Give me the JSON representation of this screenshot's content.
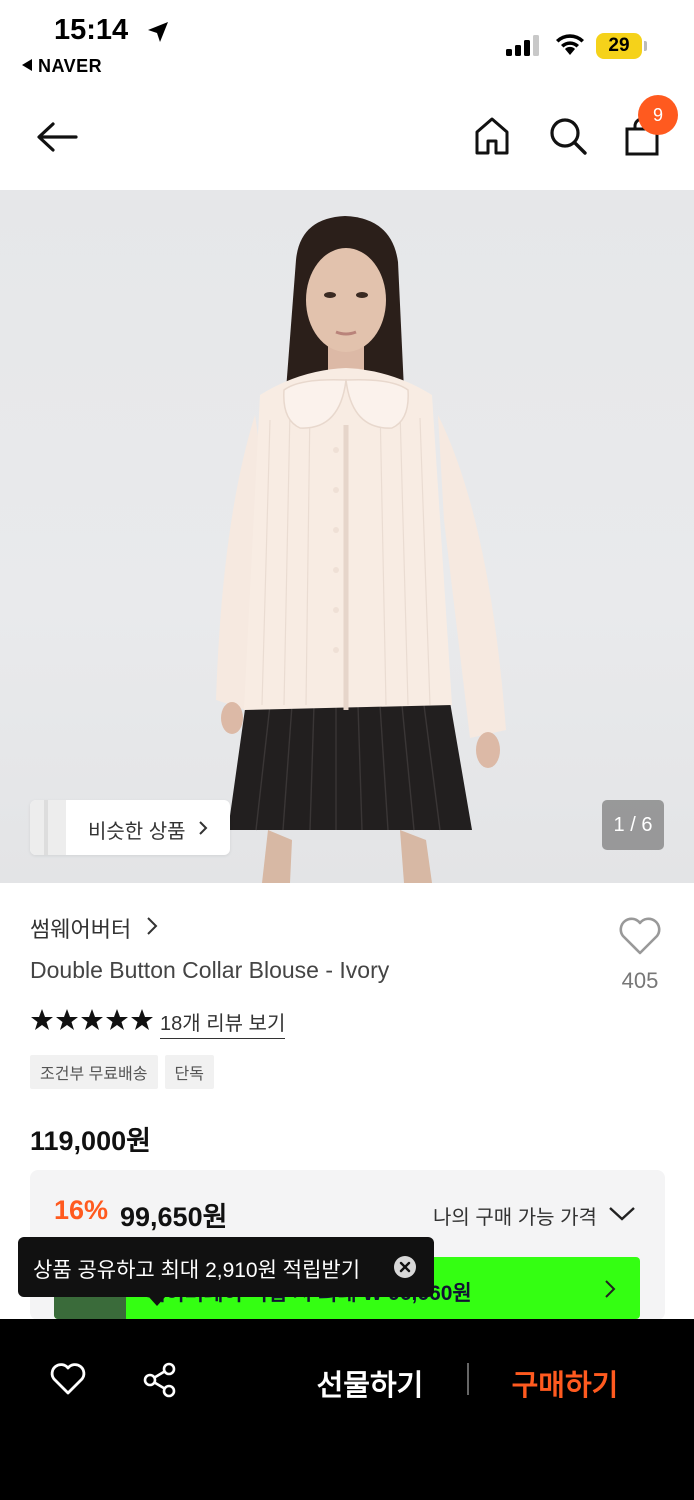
{
  "status_bar": {
    "time": "15:14",
    "back_app": "NAVER",
    "battery": "29"
  },
  "header": {
    "cart_count": "9",
    "icons": [
      "back-arrow-icon",
      "home-icon",
      "search-icon",
      "shopping-bag-icon"
    ]
  },
  "gallery": {
    "similar_label": "비슷한 상품",
    "page_indicator": "1 / 6"
  },
  "product": {
    "brand": "썸웨어버터",
    "title": "Double Button Collar Blouse - Ivory",
    "like_count": "405",
    "rating_stars": 5,
    "review_link": "18개 리뷰 보기",
    "tags": [
      "조건부 무료배송",
      "단독"
    ],
    "original_price": "119,000원"
  },
  "discount": {
    "percent": "16%",
    "price": "99,650원",
    "my_price_label": "나의 구매 가능 가격",
    "green_banner_text": "네이버페이 적립 시 최대 ₩ 96,660원"
  },
  "toast": {
    "text": "상품 공유하고 최대 2,910원 적립받기"
  },
  "bottom_bar": {
    "gift_label": "선물하기",
    "buy_label": "구매하기"
  },
  "colors": {
    "accent": "#ff5a1f",
    "banner_green": "#34ff12",
    "bottom_bar": "#000000"
  }
}
